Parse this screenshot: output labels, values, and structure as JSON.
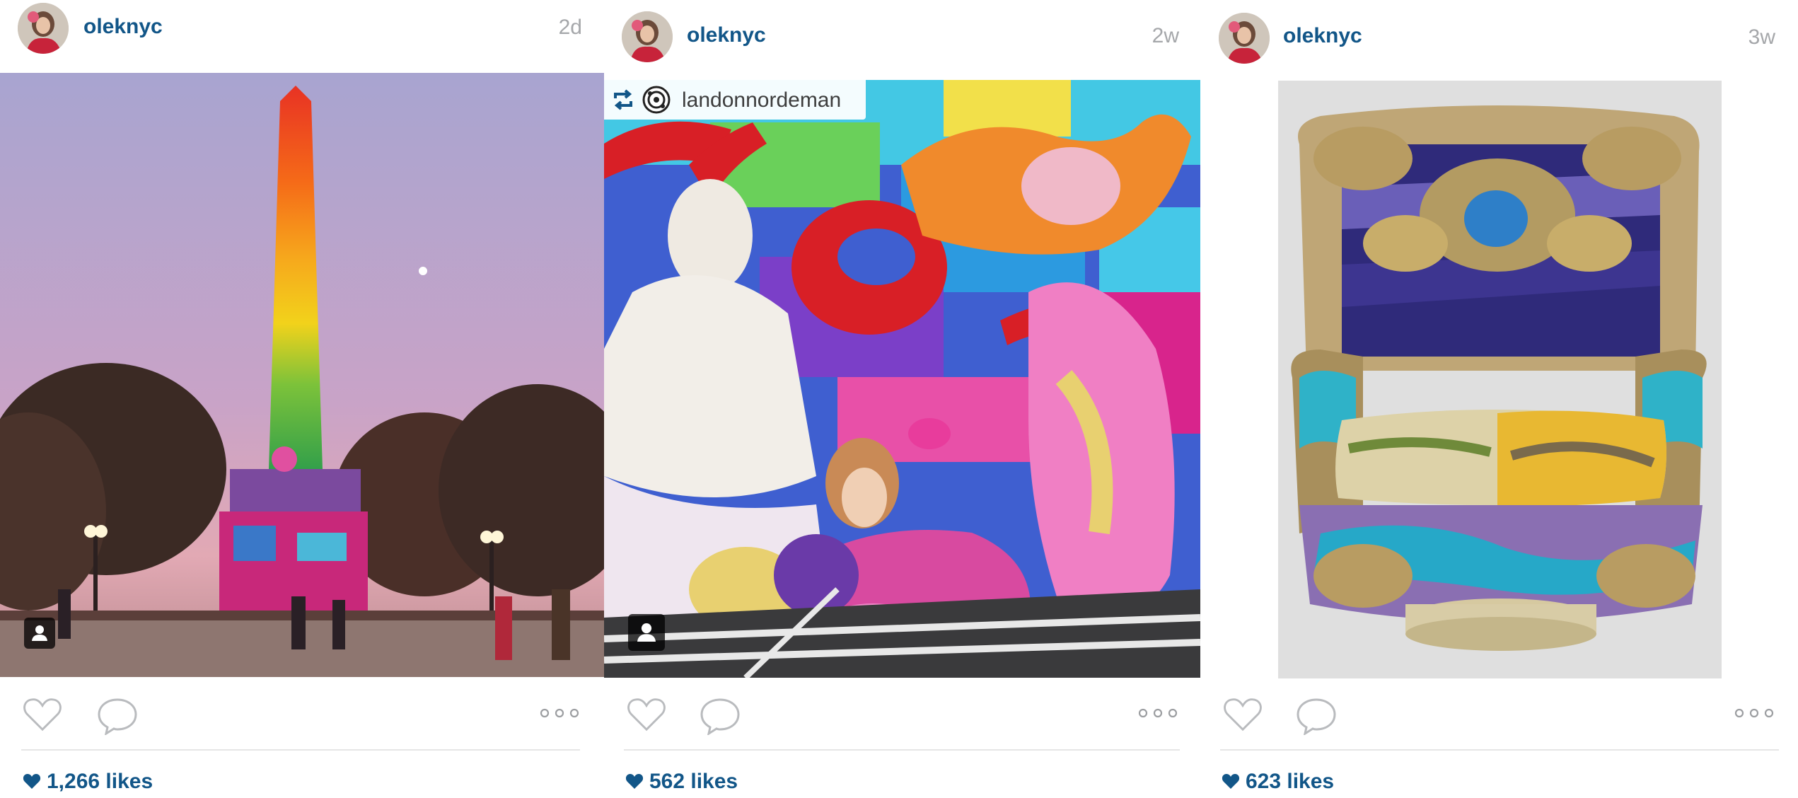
{
  "posts": [
    {
      "username": "oleknyc",
      "timestamp": "2d",
      "likes": "1,266 likes",
      "has_tag_badge": true
    },
    {
      "username": "oleknyc",
      "timestamp": "2w",
      "regram_username": "landonnordeman",
      "likes": "562 likes",
      "has_tag_badge": true
    },
    {
      "username": "oleknyc",
      "timestamp": "3w",
      "likes": "623 likes",
      "has_tag_badge": false
    }
  ],
  "icons": {
    "like": "heart-outline-icon",
    "comment": "speech-bubble-icon",
    "more": "ellipsis-icon",
    "likes_heart": "heart-filled-icon",
    "regram": "repost-arrows-icon",
    "tag": "person-tag-icon"
  },
  "colors": {
    "username": "#125688",
    "timestamp": "#a5a7aa",
    "icon_stroke": "#b9bbbe",
    "divider": "#e6e6e6"
  }
}
